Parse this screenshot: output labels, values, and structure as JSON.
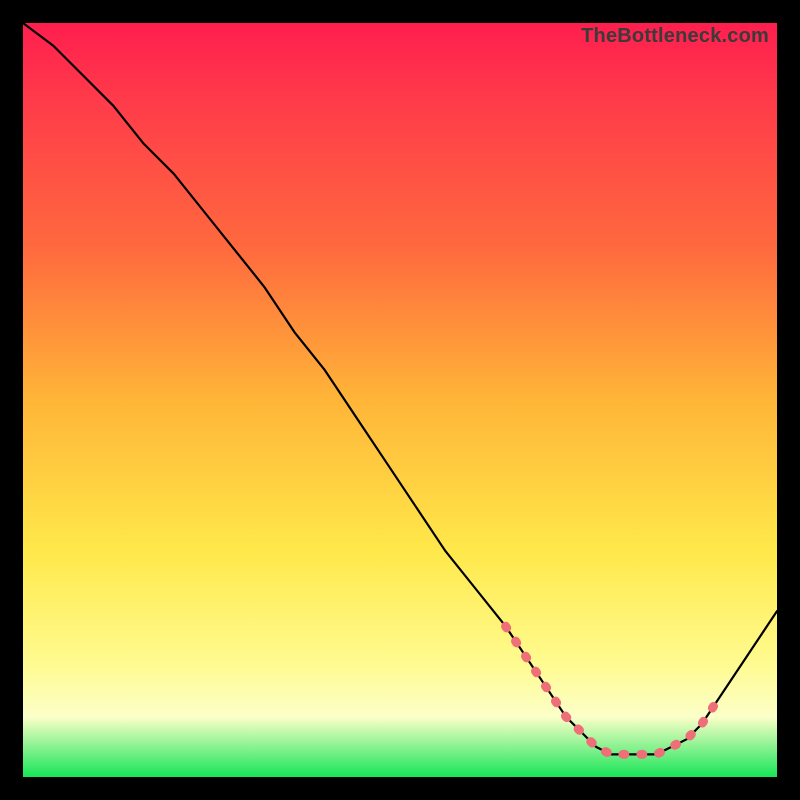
{
  "watermark": "TheBottleneck.com",
  "colors": {
    "curve": "#000000",
    "dash": "#ef6f78",
    "gradient_top": "#ff1e4e",
    "gradient_bottom": "#17e558"
  },
  "chart_data": {
    "type": "line",
    "title": "",
    "xlabel": "",
    "ylabel": "",
    "xlim": [
      0,
      100
    ],
    "ylim": [
      0,
      100
    ],
    "series": [
      {
        "name": "bottleneck-curve",
        "x": [
          0,
          4,
          8,
          12,
          16,
          20,
          24,
          28,
          32,
          36,
          40,
          44,
          48,
          52,
          56,
          60,
          64,
          68,
          70,
          72,
          74,
          76,
          78,
          80,
          82,
          84,
          86,
          88,
          90,
          92,
          94,
          96,
          98,
          100
        ],
        "y": [
          100,
          97,
          93,
          89,
          84,
          80,
          75,
          70,
          65,
          59,
          54,
          48,
          42,
          36,
          30,
          25,
          20,
          14,
          11,
          8,
          6,
          4,
          3,
          3,
          3,
          3,
          4,
          5,
          7,
          10,
          13,
          16,
          19,
          22
        ]
      },
      {
        "name": "highlight-zone",
        "x": [
          64,
          68,
          70,
          72,
          74,
          76,
          78,
          80,
          82,
          84,
          86,
          88,
          90,
          92
        ],
        "y": [
          20,
          14,
          11,
          8,
          6,
          4,
          3,
          3,
          3,
          3,
          4,
          5,
          7,
          10
        ]
      }
    ]
  }
}
